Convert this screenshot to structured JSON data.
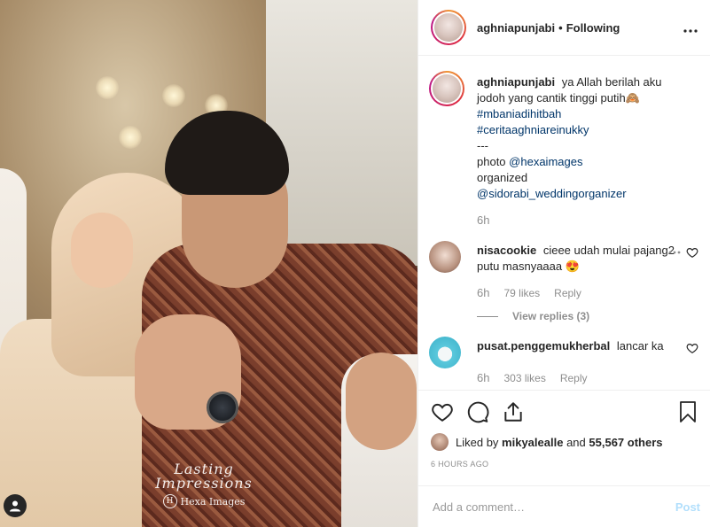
{
  "post": {
    "username": "aghniapunjabi",
    "separator": "•",
    "follow_status": "Following",
    "more_icon": "more-horizontal-icon",
    "watermark": {
      "script_text": "Lasting Impressions",
      "brand_text": "Hexa Images",
      "brand_mark": "H"
    }
  },
  "caption": {
    "username": "aghniapunjabi",
    "line1": "ya Allah berilah aku jodoh yang cantik tinggi putih🙈",
    "hashtag1": "#mbaniadihitbah",
    "hashtag2": "#ceritaaghniareinukky",
    "separator": "---",
    "photo_label": "photo",
    "photo_mention": "@hexaimages",
    "organized_label": "organized",
    "organized_mention": "@sidorabi_weddingorganizer",
    "time": "6h"
  },
  "comments": [
    {
      "username": "nisacookie",
      "text": "cieee udah mulai pajang2 putu masnyaaaa 😍",
      "time": "6h",
      "likes": "79 likes",
      "reply_label": "Reply",
      "view_replies": "View replies (3)"
    },
    {
      "username": "pusat.penggemukherbal",
      "text": "lancar ka",
      "time": "6h",
      "likes": "303 likes",
      "reply_label": "Reply"
    }
  ],
  "likes_summary": {
    "prefix": "Liked by",
    "user": "mikyalealle",
    "middle": "and",
    "count": "55,567 others"
  },
  "timestamp": "6 HOURS AGO",
  "add_comment": {
    "placeholder": "Add a comment…",
    "post_label": "Post"
  },
  "colors": {
    "link": "#003569",
    "muted": "#8e8e8e",
    "post_disabled": "#b2dffc",
    "text": "#262626"
  }
}
